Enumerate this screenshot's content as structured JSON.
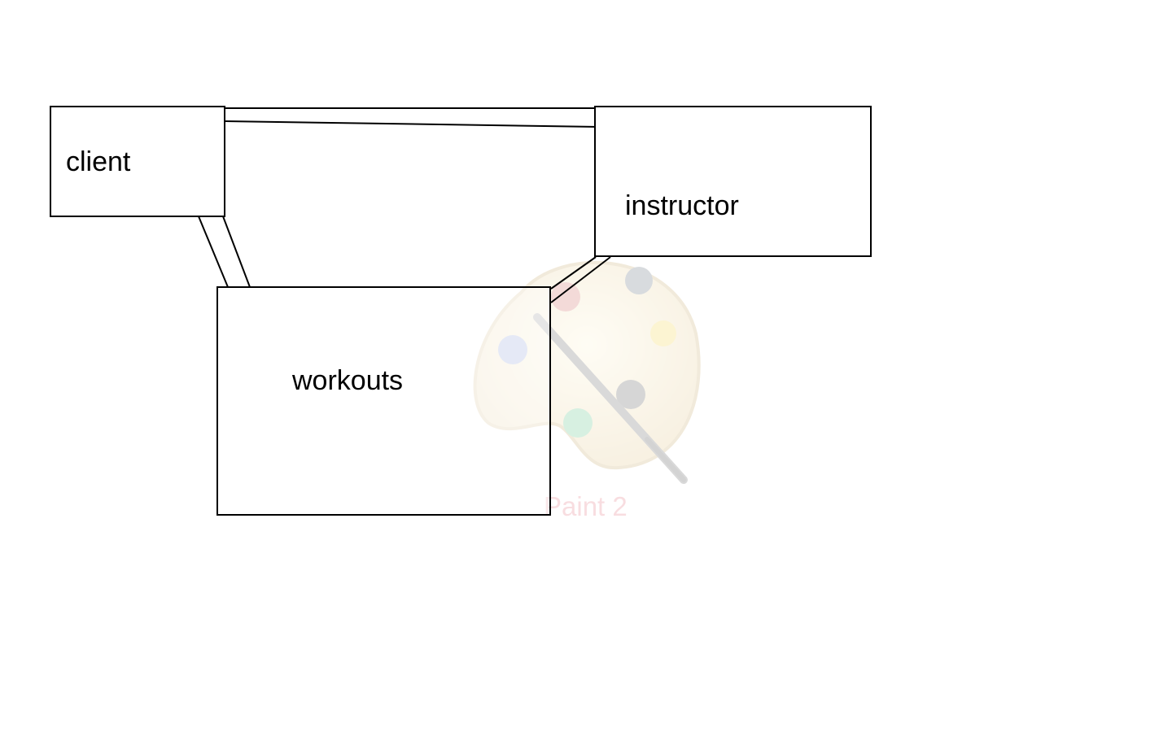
{
  "entities": {
    "client": {
      "label": "client"
    },
    "instructor": {
      "label": "instructor"
    },
    "workouts": {
      "label": "workouts"
    }
  },
  "watermark": {
    "icon": "paint-palette-icon",
    "label": "Paint 2"
  },
  "colors": {
    "background": "#ffffff",
    "stroke": "#000000",
    "watermark_label": "#f3c2c8"
  }
}
